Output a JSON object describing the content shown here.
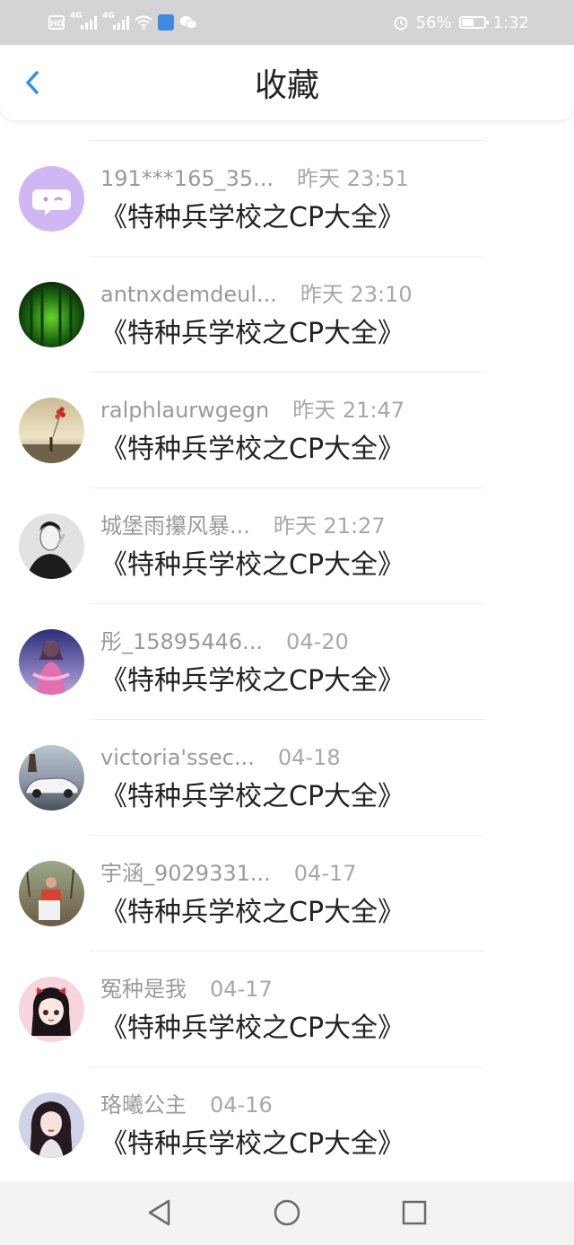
{
  "status_bar": {
    "hd": "HD",
    "sim1": "4G",
    "sim2": "4G",
    "battery_text": "56%",
    "battery_level": 0.56,
    "time": "1:32"
  },
  "header": {
    "title": "收藏"
  },
  "items": [
    {
      "user": "191***165_35...",
      "time": "昨天 23:51",
      "title": "《特种兵学校之CP大全》"
    },
    {
      "user": "antnxdemdeul...",
      "time": "昨天 23:10",
      "title": "《特种兵学校之CP大全》"
    },
    {
      "user": "ralphlaurwgegn",
      "time": "昨天 21:47",
      "title": "《特种兵学校之CP大全》"
    },
    {
      "user": "城堡雨攥风暴...",
      "time": "昨天 21:27",
      "title": "《特种兵学校之CP大全》"
    },
    {
      "user": "彤_15895446...",
      "time": "04-20",
      "title": "《特种兵学校之CP大全》"
    },
    {
      "user": "victoria'ssec...",
      "time": "04-18",
      "title": "《特种兵学校之CP大全》"
    },
    {
      "user": "宇涵_9029331...",
      "time": "04-17",
      "title": "《特种兵学校之CP大全》"
    },
    {
      "user": "冤种是我",
      "time": "04-17",
      "title": "《特种兵学校之CP大全》"
    },
    {
      "user": "珞曦公主",
      "time": "04-16",
      "title": "《特种兵学校之CP大全》"
    }
  ],
  "colors": {
    "accent": "#2f8ff0",
    "status_bar_bg": "#d4d4d4",
    "nav_bar_bg": "#f3f3f3"
  },
  "icons": {
    "back": "chevron-left-icon",
    "nav_back": "triangle-back-icon",
    "nav_home": "circle-home-icon",
    "nav_recent": "square-recent-icon"
  }
}
